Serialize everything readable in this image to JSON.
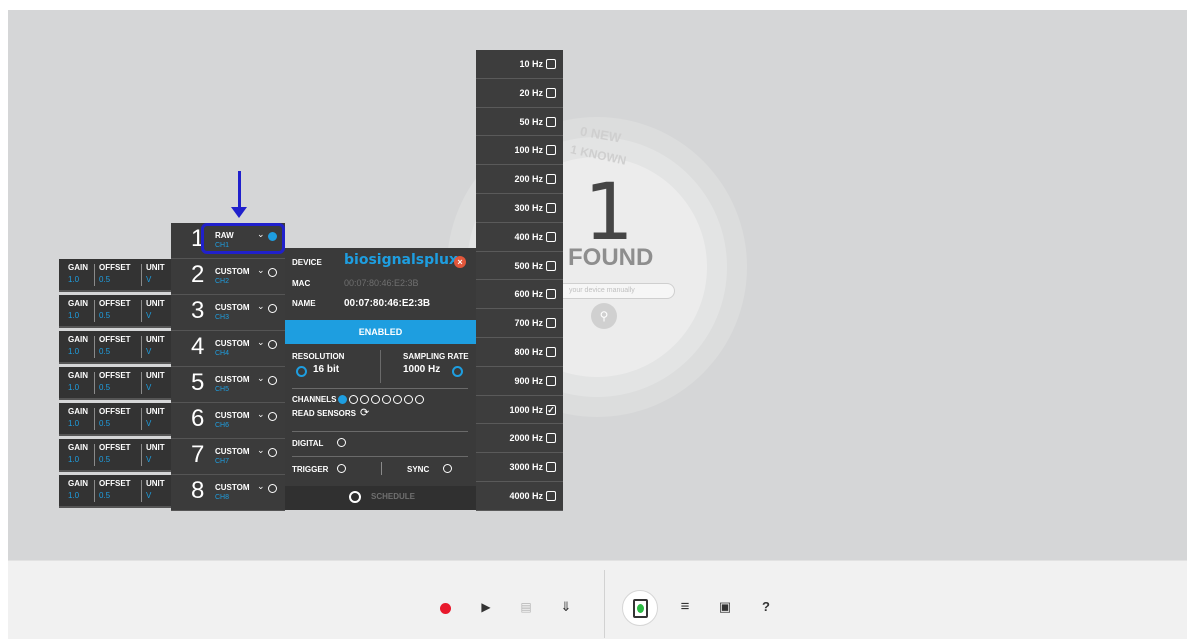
{
  "background": {
    "new_text": "0 NEW",
    "known_text": "1 KNOWN",
    "found_count": "1",
    "found_label": "FOUND",
    "manual_placeholder": "your device manually"
  },
  "params": {
    "gain_label": "GAIN",
    "offset_label": "OFFSET",
    "unit_label": "UNIT",
    "rows": [
      {
        "gain": "1.0",
        "offset": "0.5",
        "unit": "V"
      },
      {
        "gain": "1.0",
        "offset": "0.5",
        "unit": "V"
      },
      {
        "gain": "1.0",
        "offset": "0.5",
        "unit": "V"
      },
      {
        "gain": "1.0",
        "offset": "0.5",
        "unit": "V"
      },
      {
        "gain": "1.0",
        "offset": "0.5",
        "unit": "V"
      },
      {
        "gain": "1.0",
        "offset": "0.5",
        "unit": "V"
      },
      {
        "gain": "1.0",
        "offset": "0.5",
        "unit": "V"
      }
    ]
  },
  "channels": [
    {
      "num": "1",
      "type": "RAW",
      "sub": "CH1",
      "active": true
    },
    {
      "num": "2",
      "type": "CUSTOM",
      "sub": "CH2",
      "active": false
    },
    {
      "num": "3",
      "type": "CUSTOM",
      "sub": "CH3",
      "active": false
    },
    {
      "num": "4",
      "type": "CUSTOM",
      "sub": "CH4",
      "active": false
    },
    {
      "num": "5",
      "type": "CUSTOM",
      "sub": "CH5",
      "active": false
    },
    {
      "num": "6",
      "type": "CUSTOM",
      "sub": "CH6",
      "active": false
    },
    {
      "num": "7",
      "type": "CUSTOM",
      "sub": "CH7",
      "active": false
    },
    {
      "num": "8",
      "type": "CUSTOM",
      "sub": "CH8",
      "active": false
    }
  ],
  "device": {
    "device_label": "DEVICE",
    "brand_name": "biosignalsplux",
    "mac_label": "MAC",
    "mac_value": "00:07:80:46:E2:3B",
    "name_label": "NAME",
    "name_value": "00:07:80:46:E2:3B",
    "enabled_label": "ENABLED",
    "resolution_label": "RESOLUTION",
    "resolution_value": "16 bit",
    "sampling_label": "SAMPLING RATE",
    "sampling_value": "1000 Hz",
    "channels_label": "CHANNELS",
    "read_sensors_label": "READ SENSORS",
    "digital_label": "DIGITAL",
    "trigger_label": "TRIGGER",
    "sync_label": "SYNC",
    "schedule_label": "SCHEDULE",
    "accent_color": "#1e9ee0",
    "close_color": "#e2573b"
  },
  "rates": [
    {
      "label": "10 Hz",
      "checked": false
    },
    {
      "label": "20 Hz",
      "checked": false
    },
    {
      "label": "50 Hz",
      "checked": false
    },
    {
      "label": "100 Hz",
      "checked": false
    },
    {
      "label": "200 Hz",
      "checked": false
    },
    {
      "label": "300 Hz",
      "checked": false
    },
    {
      "label": "400 Hz",
      "checked": false
    },
    {
      "label": "500 Hz",
      "checked": false
    },
    {
      "label": "600 Hz",
      "checked": false
    },
    {
      "label": "700 Hz",
      "checked": false
    },
    {
      "label": "800 Hz",
      "checked": false
    },
    {
      "label": "900 Hz",
      "checked": false
    },
    {
      "label": "1000 Hz",
      "checked": true
    },
    {
      "label": "2000 Hz",
      "checked": false
    },
    {
      "label": "3000 Hz",
      "checked": false
    },
    {
      "label": "4000 Hz",
      "checked": false
    }
  ],
  "toolbar": {
    "record_icon": "record-icon",
    "play_icon": "play-icon",
    "file_icon": "file-icon",
    "download_icon": "download-icon",
    "device_icon": "device-icon",
    "settings_icon": "sliders-icon",
    "cart_icon": "cart-icon",
    "help_label": "?"
  }
}
